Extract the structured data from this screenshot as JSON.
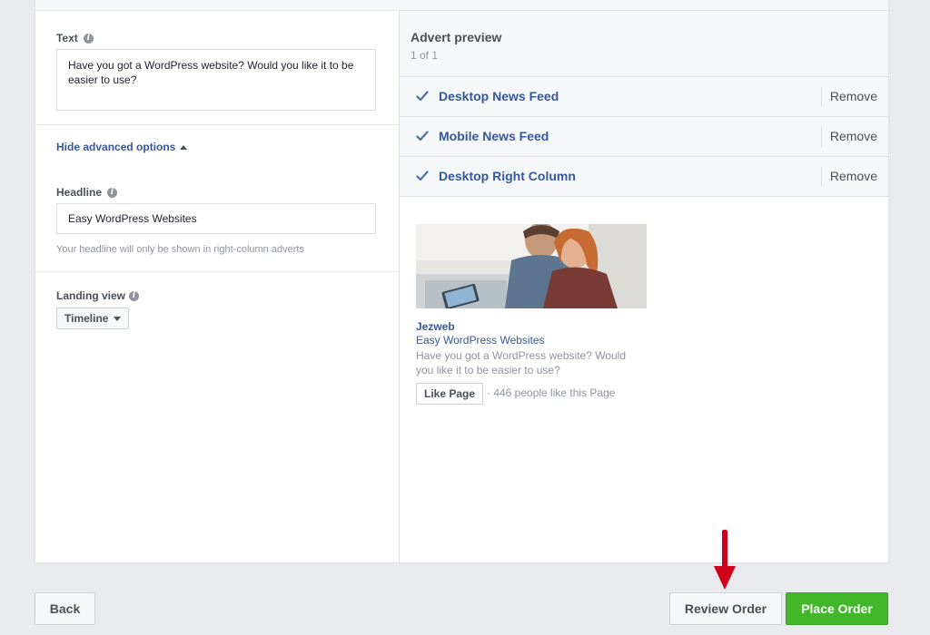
{
  "left": {
    "text": {
      "label": "Text",
      "value": "Have you got a WordPress website? Would you like it to be easier to use?"
    },
    "advanced": {
      "toggle_label": "Hide advanced options",
      "headline_label": "Headline",
      "headline_value": "Easy WordPress Websites",
      "headline_help": "Your headline will only be shown in right-column adverts"
    },
    "landing": {
      "label": "Landing view",
      "selected": "Timeline"
    }
  },
  "preview": {
    "title": "Advert preview",
    "count": "1 of 1",
    "placements": [
      {
        "label": "Desktop News Feed",
        "action": "Remove"
      },
      {
        "label": "Mobile News Feed",
        "action": "Remove"
      },
      {
        "label": "Desktop Right Column",
        "action": "Remove"
      }
    ],
    "ad": {
      "page_name": "Jezweb",
      "headline": "Easy WordPress Websites",
      "body": "Have you got a WordPress website? Would you like it to be easier to use?",
      "like_button": "Like Page",
      "like_count": "· 446 people like this Page"
    }
  },
  "footer": {
    "back_label": "Back",
    "review_label": "Review Order",
    "place_label": "Place Order"
  },
  "colors": {
    "link_blue": "#365899",
    "place_green": "#42b72a",
    "arrow_red": "#d0021b",
    "page_bg": "#e9eaed"
  },
  "icons": [
    "info-icon",
    "caret-up-icon",
    "caret-down-icon",
    "checkmark-icon",
    "red-arrow-pointer"
  ]
}
